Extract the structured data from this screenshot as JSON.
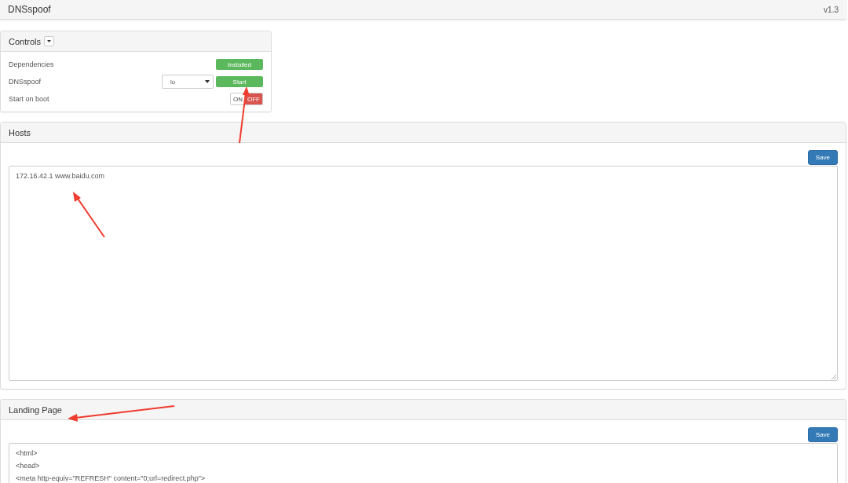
{
  "header": {
    "title": "DNSspoof",
    "version": "v1.3"
  },
  "controls": {
    "title": "Controls",
    "rows": [
      {
        "kind": "status",
        "label": "Dependencies",
        "button": "Installed"
      },
      {
        "kind": "action",
        "label": "DNSspoof",
        "select": "lo",
        "button": "Start"
      },
      {
        "kind": "toggle",
        "label": "Start on boot",
        "on_label": "ON",
        "off_label": "OFF",
        "on": false
      }
    ]
  },
  "hosts": {
    "title": "Hosts",
    "save": "Save",
    "lines": [
      "172.16.42.1 www.baidu.com"
    ]
  },
  "landing_page": {
    "title": "Landing Page",
    "save": "Save",
    "lines": [
      "<html>",
      "<head>",
      "<meta http-equiv=\"REFRESH\" content=\"0;url=redirect.php\">"
    ]
  }
}
